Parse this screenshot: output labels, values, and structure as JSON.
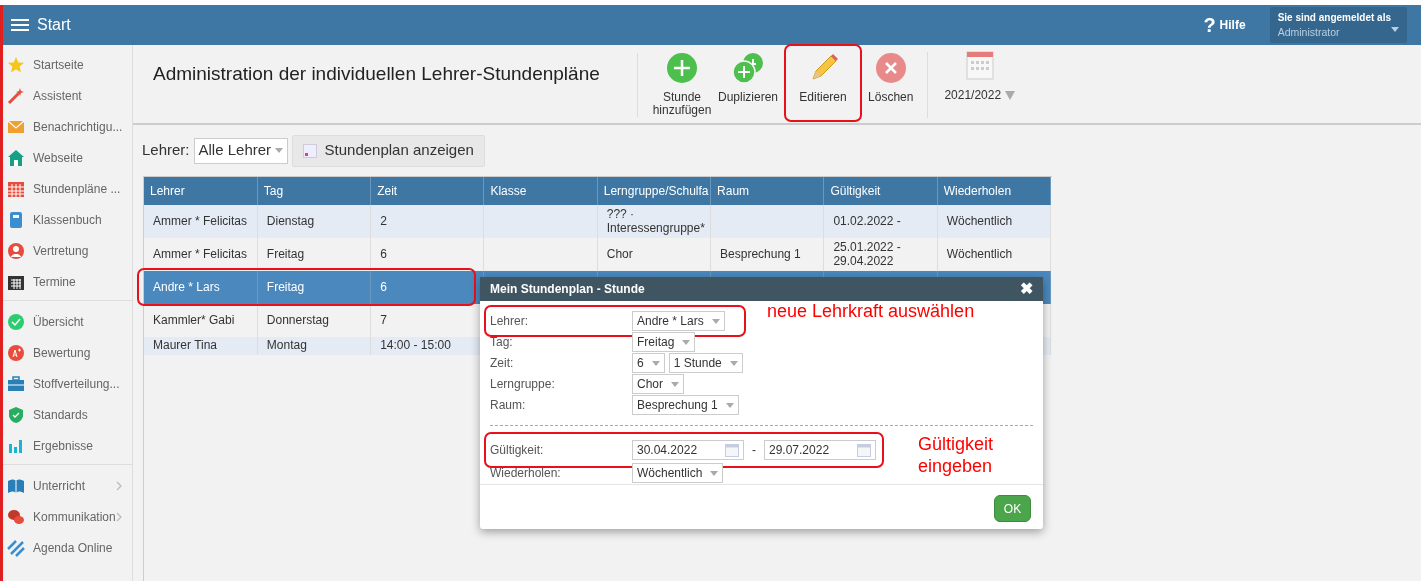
{
  "topbar": {
    "title": "Start",
    "help_icon": "?",
    "help": "Hilfe",
    "user_caption": "Sie sind angemeldet als",
    "user_name": "Administrator"
  },
  "sidebar": {
    "sections": [
      {
        "items": [
          {
            "label": "Startseite",
            "has_submenu": false
          },
          {
            "label": "Assistent",
            "has_submenu": false
          },
          {
            "label": "Benachrichtigu...",
            "has_submenu": false
          },
          {
            "label": "Webseite",
            "has_submenu": false
          },
          {
            "label": "Stundenpläne ...",
            "has_submenu": false
          },
          {
            "label": "Klassenbuch",
            "has_submenu": false
          },
          {
            "label": "Vertretung",
            "has_submenu": false
          },
          {
            "label": "Termine",
            "has_submenu": false
          }
        ]
      },
      {
        "items": [
          {
            "label": "Übersicht",
            "has_submenu": false
          },
          {
            "label": "Bewertung",
            "has_submenu": false
          },
          {
            "label": "Stoffverteilung...",
            "has_submenu": false
          },
          {
            "label": "Standards",
            "has_submenu": false
          },
          {
            "label": "Ergebnisse",
            "has_submenu": false
          }
        ]
      },
      {
        "items": [
          {
            "label": "Unterricht",
            "has_submenu": true
          },
          {
            "label": "Kommunikation",
            "has_submenu": true
          },
          {
            "label": "Agenda Online",
            "has_submenu": false
          }
        ]
      }
    ]
  },
  "page_title": "Administration der individuellen Lehrer-Stundenpläne",
  "toolbar": {
    "buttons": [
      {
        "label": "Stunde hinzufügen",
        "highlighted": false
      },
      {
        "label": "Duplizieren",
        "highlighted": false
      },
      {
        "label": "Editieren",
        "highlighted": true
      },
      {
        "label": "Löschen",
        "highlighted": false
      }
    ],
    "year": "2021/2022"
  },
  "filter": {
    "label": "Lehrer:",
    "value": "Alle Lehrer",
    "button": "Stundenplan anzeigen"
  },
  "table": {
    "columns": [
      "Lehrer",
      "Tag",
      "Zeit",
      "Klasse",
      "Lerngruppe/Schulfa",
      "Raum",
      "Gültigkeit",
      "Wiederholen"
    ],
    "rows": [
      {
        "selected": false,
        "highlighted": false,
        "cells": [
          "Ammer * Felicitas",
          "Dienstag",
          "2",
          "",
          "??? · Interessengruppe*",
          "",
          "01.02.2022 -",
          "Wöchentlich"
        ]
      },
      {
        "selected": false,
        "highlighted": false,
        "cells": [
          "Ammer * Felicitas",
          "Freitag",
          "6",
          "",
          "Chor",
          "Besprechung 1",
          "25.01.2022 - 29.04.2022",
          "Wöchentlich"
        ]
      },
      {
        "selected": true,
        "highlighted": true,
        "cells": [
          "Andre * Lars",
          "Freitag",
          "6"
        ]
      },
      {
        "selected": false,
        "highlighted": false,
        "cells": [
          "Kammler* Gabi",
          "Donnerstag",
          "7"
        ]
      },
      {
        "selected": false,
        "highlighted": false,
        "cells": [
          "Maurer Tina",
          "Montag",
          "14:00 - 15:00"
        ]
      }
    ]
  },
  "dialog": {
    "title": "Mein Stundenplan - Stunde",
    "fields": [
      {
        "kind": "select",
        "label": "Lehrer:",
        "values": [
          "Andre * Lars"
        ],
        "highlighted": true,
        "annotation": "neue Lehrkraft auswählen"
      },
      {
        "kind": "select",
        "label": "Tag:",
        "values": [
          "Freitag"
        ],
        "highlighted": false
      },
      {
        "kind": "select",
        "label": "Zeit:",
        "values": [
          "6",
          "1 Stunde"
        ],
        "highlighted": false
      },
      {
        "kind": "select",
        "label": "Lerngruppe:",
        "values": [
          "Chor"
        ],
        "highlighted": false
      },
      {
        "kind": "select",
        "label": "Raum:",
        "values": [
          "Besprechung 1"
        ],
        "highlighted": false
      },
      {
        "kind": "divider"
      },
      {
        "kind": "date_range",
        "label": "Gültigkeit:",
        "values": [
          "30.04.2022",
          "29.07.2022"
        ],
        "separator": "-",
        "highlighted": true,
        "annotation": "Gültigkeit eingeben"
      },
      {
        "kind": "select",
        "label": "Wiederholen:",
        "values": [
          "Wöchentlich"
        ],
        "highlighted": false
      }
    ],
    "close": "✖",
    "ok": "OK"
  }
}
